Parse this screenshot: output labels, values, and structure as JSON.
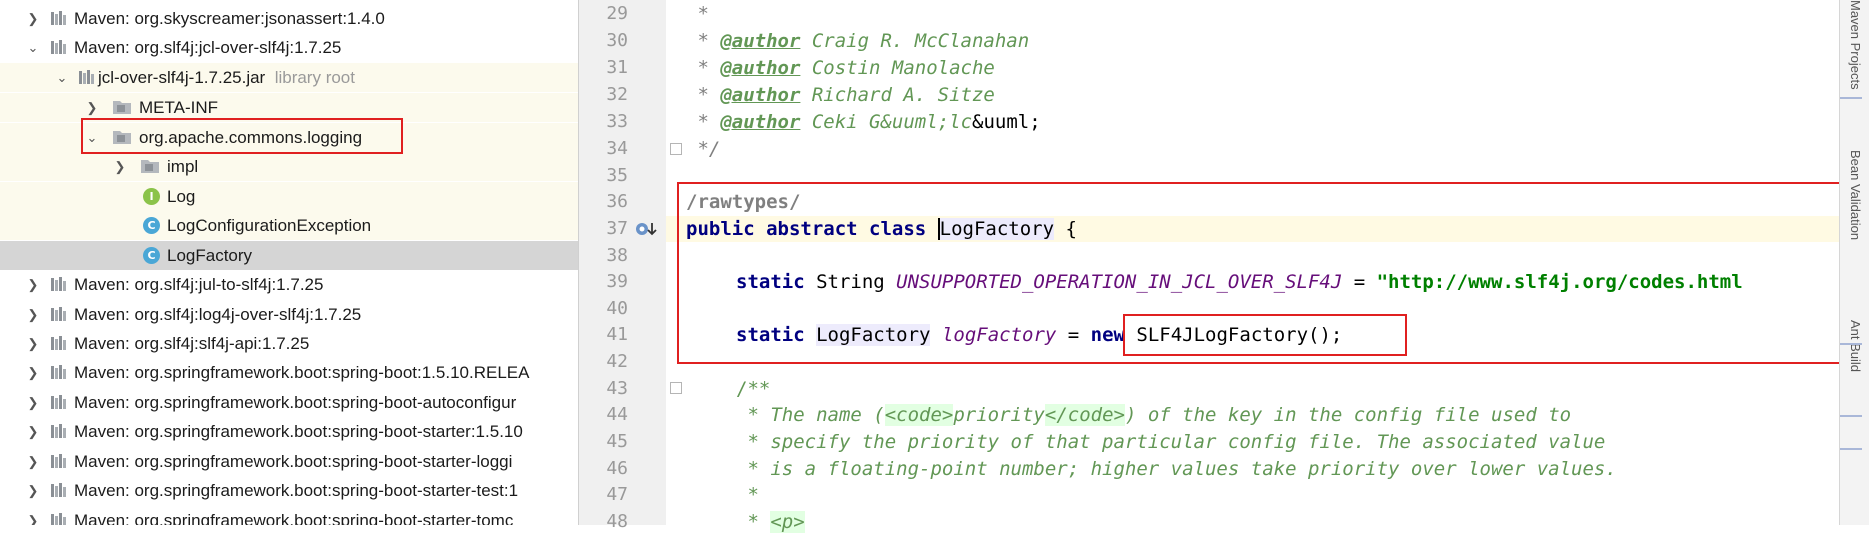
{
  "tree": {
    "items": [
      {
        "label": "Maven: org.skyscreamer:jsonassert:1.4.0",
        "expanded": false,
        "icon": "library-icon"
      },
      {
        "label": "Maven: org.slf4j:jcl-over-slf4j:1.7.25",
        "expanded": true,
        "icon": "library-icon"
      },
      {
        "label": "jcl-over-slf4j-1.7.25.jar",
        "suffix": "library root",
        "expanded": true,
        "icon": "jar-icon"
      },
      {
        "label": "META-INF",
        "expanded": false,
        "icon": "package-icon"
      },
      {
        "label": "org.apache.commons.logging",
        "expanded": true,
        "icon": "package-icon"
      },
      {
        "label": "impl",
        "expanded": false,
        "icon": "package-icon"
      },
      {
        "label": "Log",
        "icon": "interface-icon",
        "icon_letter": "I"
      },
      {
        "label": "LogConfigurationException",
        "icon": "class-icon",
        "icon_letter": "C"
      },
      {
        "label": "LogFactory",
        "icon": "class-icon",
        "icon_letter": "C",
        "selected": true
      },
      {
        "label": "Maven: org.slf4j:jul-to-slf4j:1.7.25",
        "expanded": false,
        "icon": "library-icon"
      },
      {
        "label": "Maven: org.slf4j:log4j-over-slf4j:1.7.25",
        "expanded": false,
        "icon": "library-icon"
      },
      {
        "label": "Maven: org.slf4j:slf4j-api:1.7.25",
        "expanded": false,
        "icon": "library-icon"
      },
      {
        "label": "Maven: org.springframework.boot:spring-boot:1.5.10.RELEA",
        "expanded": false,
        "icon": "library-icon"
      },
      {
        "label": "Maven: org.springframework.boot:spring-boot-autoconfigur",
        "expanded": false,
        "icon": "library-icon"
      },
      {
        "label": "Maven: org.springframework.boot:spring-boot-starter:1.5.10",
        "expanded": false,
        "icon": "library-icon"
      },
      {
        "label": "Maven: org.springframework.boot:spring-boot-starter-loggi",
        "expanded": false,
        "icon": "library-icon"
      },
      {
        "label": "Maven: org.springframework.boot:spring-boot-starter-test:1",
        "expanded": false,
        "icon": "library-icon"
      },
      {
        "label": "Maven: org.springframework.boot:spring-boot-starter-tomc",
        "expanded": false,
        "icon": "library-icon"
      }
    ]
  },
  "editor": {
    "line_numbers": [
      "29",
      "30",
      "31",
      "32",
      "33",
      "34",
      "35",
      "36",
      "37",
      "38",
      "39",
      "40",
      "41",
      "42",
      "43",
      "44",
      "45",
      "46",
      "47",
      "48"
    ],
    "lines": {
      "l29": " *",
      "l30_tag": "@author",
      "l30_text": " Craig R. McClanahan",
      "l31_tag": "@author",
      "l31_text": " Costin Manolache",
      "l32_tag": "@author",
      "l32_text": " Richard A. Sitze",
      "l33_tag": "@author",
      "l33_text_a": " Ceki G&uuml;",
      "l33_text_b": "lc",
      "l33_text_c": "&uuml;",
      "l34": " */",
      "l36": "/rawtypes/",
      "l37_kw": "public abstract class",
      "l37_name": "LogFactory",
      "l37_rest": " {",
      "l39_kw": "static",
      "l39_type": " String ",
      "l39_field": "UNSUPPORTED_OPERATION_IN_JCL_OVER_SLF4J",
      "l39_eq": " = ",
      "l39_str": "\"http://www.slf4j.org/codes.html",
      "l41_kw": "static",
      "l41_type": "LogFactory",
      "l41_field": "logFactory",
      "l41_eq": " = ",
      "l41_new": "new",
      "l41_rest": " SLF4JLogFactory();",
      "l43": "/**",
      "l44_a": " * The name (",
      "l44_b": "<code>",
      "l44_c": "priority",
      "l44_d": "</code>",
      "l44_e": ") of the key in the config file used to",
      "l45": " * specify the priority of that particular config file. The associated value",
      "l46": " * is a floating-point number; higher values take priority over lower values.",
      "l47": " *",
      "l48_a": " * ",
      "l48_b": "<p>"
    }
  },
  "right_toolwindows": [
    "Maven Projects",
    "Bean Validation",
    "Ant Build"
  ]
}
